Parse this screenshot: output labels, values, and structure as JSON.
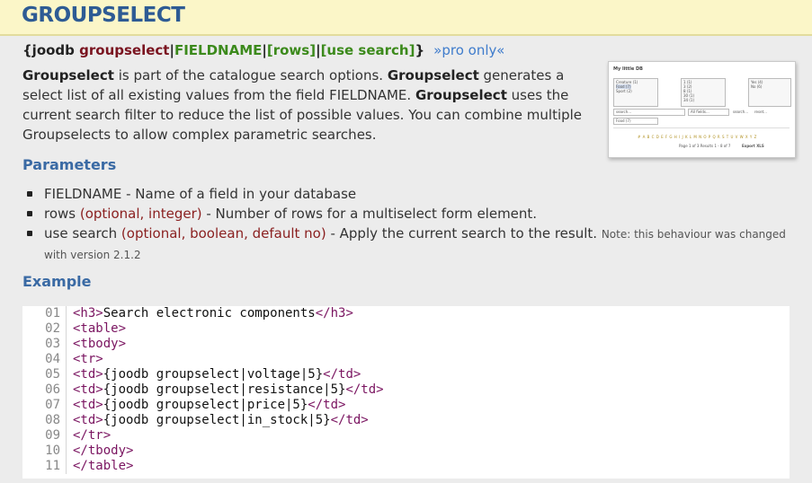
{
  "header": {
    "title": "GROUPSELECT"
  },
  "syntax": {
    "open": "{joodb ",
    "keyword": "groupselect",
    "sep1": "|",
    "field": "FIELDNAME",
    "sep2": "|",
    "rows": "[rows]",
    "sep3": "|",
    "use_search": "[use search]",
    "close": "}",
    "pro": "»pro only«"
  },
  "description": {
    "b1": "Groupselect",
    "t1": " is part of the catalogue search options. ",
    "b2": "Groupselect",
    "t2": " generates a select list of all existing values from the field FIELDNAME. ",
    "b3": "Groupselect",
    "t3": " uses the current search filter to reduce the list of possible values. You can combine multiple Groupselects to allow complex parametric searches."
  },
  "thumbnail": {
    "title": "My little DB",
    "list1": [
      "Creature (1)",
      "Food (7)",
      "Sport (2)"
    ],
    "list2": [
      "1 (1)",
      "3 (2)",
      "8 (1)",
      "30 (1)",
      "34 (1)"
    ],
    "list3": [
      "Yes (4)",
      "No (6)"
    ],
    "search_placeholder": "search...",
    "all_fields": "All fields...",
    "search_btn": "search...",
    "reset_btn": "reset...",
    "food_select": "Food (7)",
    "letters": "# A B C D E F G H I J K L M N O P Q R S T U V W X Y Z",
    "pagination": "Page 1 of 3 Results 1 - 8 of 7",
    "export": "Export XLS"
  },
  "parameters": {
    "heading": "Parameters",
    "items": [
      {
        "name": "FIELDNAME",
        "opt": "",
        "desc": " - Name of a field in your database",
        "note": ""
      },
      {
        "name": "rows ",
        "opt": "(optional, integer)",
        "desc": " - Number of rows for a multiselect form element.",
        "note": ""
      },
      {
        "name": "use search ",
        "opt": "(optional, boolean, default no)",
        "desc": " - Apply the current search to the result. ",
        "note": "Note: this behaviour was changed with version 2.1.2"
      }
    ]
  },
  "example": {
    "heading": "Example",
    "lines": [
      {
        "num": "01",
        "tag1": "<h3>",
        "text": "Search electronic components",
        "tag2": "</h3>"
      },
      {
        "num": "02",
        "tag1": "<table>",
        "text": "",
        "tag2": ""
      },
      {
        "num": "03",
        "tag1": "<tbody>",
        "text": "",
        "tag2": ""
      },
      {
        "num": "04",
        "tag1": "<tr>",
        "text": "",
        "tag2": ""
      },
      {
        "num": "05",
        "tag1": "<td>",
        "text": "{joodb groupselect|voltage|5}",
        "tag2": "</td>"
      },
      {
        "num": "06",
        "tag1": "<td>",
        "text": "{joodb groupselect|resistance|5}",
        "tag2": "</td>"
      },
      {
        "num": "07",
        "tag1": "<td>",
        "text": "{joodb groupselect|price|5}",
        "tag2": "</td>"
      },
      {
        "num": "08",
        "tag1": "<td>",
        "text": "{joodb groupselect|in_stock|5}",
        "tag2": "</td>"
      },
      {
        "num": "09",
        "tag1": "</tr>",
        "text": "",
        "tag2": ""
      },
      {
        "num": "10",
        "tag1": "</tbody>",
        "text": "",
        "tag2": ""
      },
      {
        "num": "11",
        "tag1": "</table>",
        "text": "",
        "tag2": ""
      }
    ]
  }
}
